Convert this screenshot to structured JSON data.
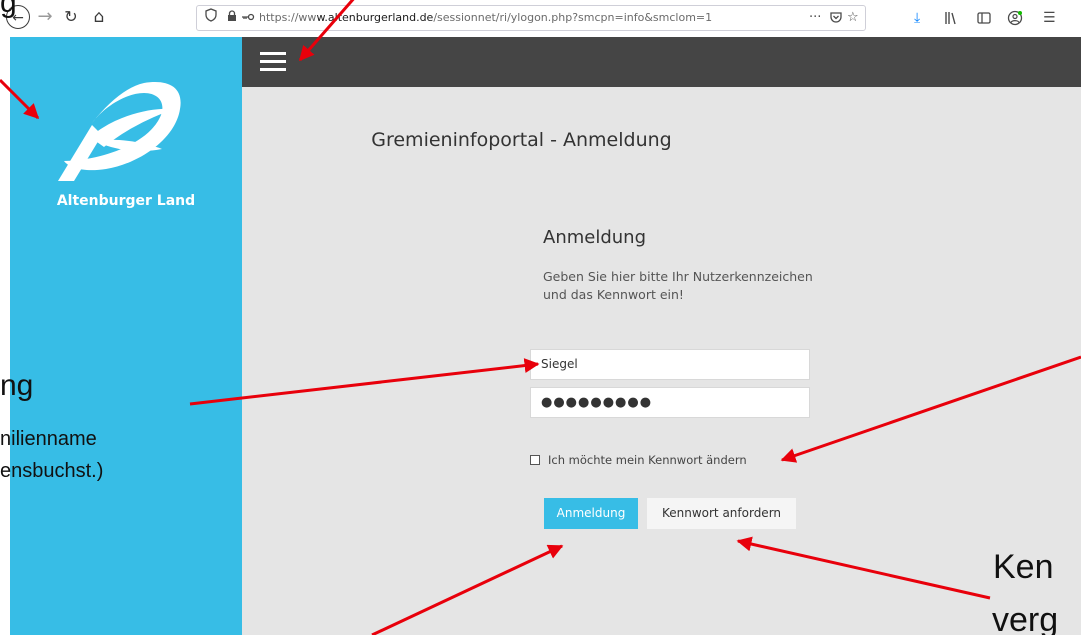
{
  "browser": {
    "url_prefix": "https://ww",
    "url_domain": "w.altenburgerland.de",
    "url_path": "/sessionnet/ri/ylogon.php?smcpn=info&smclom=1",
    "icons": {
      "back": "back-arrow-icon",
      "forward": "forward-arrow-icon",
      "reload": "reload-icon",
      "home": "home-icon",
      "shield": "shield-icon",
      "lock": "lock-icon",
      "key": "key-icon",
      "more": "more-dots-icon",
      "pocket": "pocket-icon",
      "bookmark": "bookmark-star-icon",
      "download": "download-icon",
      "library": "library-icon",
      "sidebar": "sidebar-icon",
      "account": "account-icon",
      "menu": "menu-icon"
    }
  },
  "sidebar": {
    "logo_text": "Altenburger Land",
    "color": "#37bde6"
  },
  "header": {
    "menu_icon": "hamburger-menu-icon",
    "color": "#454545"
  },
  "main": {
    "page_title": "Gremieninfoportal - Anmeldung",
    "form_title": "Anmeldung",
    "form_text": "Geben Sie hier bitte Ihr Nutzerkennzeichen und das Kennwort ein!",
    "username_value": "Siegel",
    "password_value": "●●●●●●●●●",
    "checkbox_label": "Ich möchte mein Kennwort ändern",
    "login_button": "Anmeldung",
    "request_button": "Kennwort anfordern"
  },
  "annotations": {
    "top_fragment": "g",
    "left_large": "ng",
    "left_line1": "nilienname",
    "left_line2": "ensbuchst.)",
    "right_line1": "Ken",
    "right_line2": "verg",
    "arrow_color": "#e8000b"
  }
}
